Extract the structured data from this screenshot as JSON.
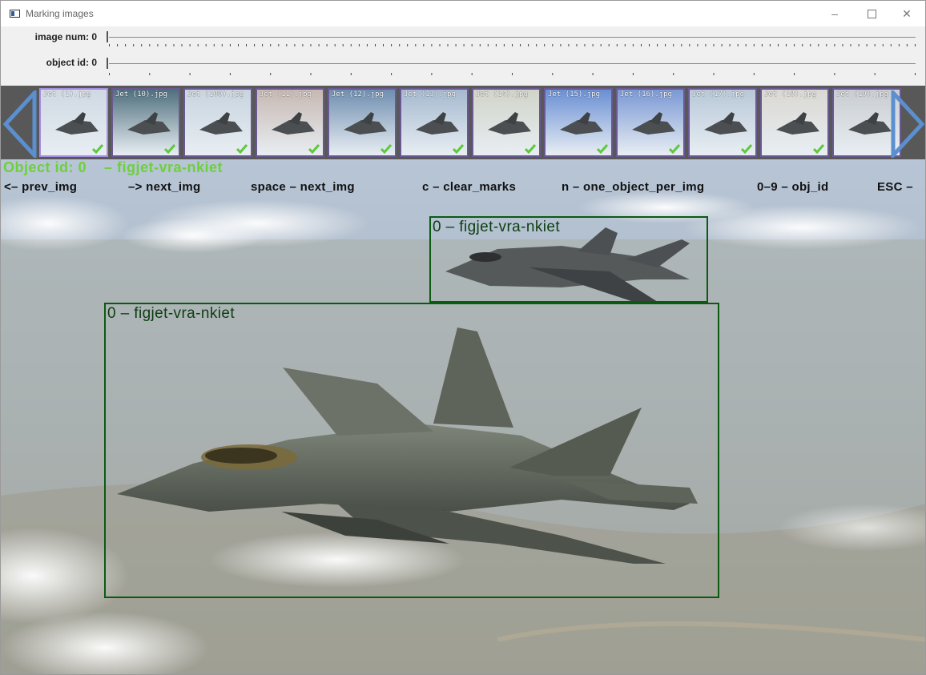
{
  "window": {
    "title": "Marking images",
    "controls": {
      "minimize": "–",
      "maximize": "□",
      "close": "✕"
    }
  },
  "trackbars": [
    {
      "label": "image num: 0",
      "value": 0
    },
    {
      "label": "object id: 0",
      "value": 0
    }
  ],
  "thumbnails": [
    {
      "caption": "Jet (1).jpg",
      "marked": true,
      "selected": true
    },
    {
      "caption": "Jet (10).jpg",
      "marked": true,
      "selected": false
    },
    {
      "caption": "Jet (100).jpg",
      "marked": true,
      "selected": false
    },
    {
      "caption": "Jet (11).jpg",
      "marked": true,
      "selected": false
    },
    {
      "caption": "Jet (12).jpg",
      "marked": true,
      "selected": false
    },
    {
      "caption": "Jet (13).jpg",
      "marked": true,
      "selected": false
    },
    {
      "caption": "Jet (14).jpg",
      "marked": true,
      "selected": false
    },
    {
      "caption": "Jet (15).jpg",
      "marked": true,
      "selected": false
    },
    {
      "caption": "Jet (16).jpg",
      "marked": true,
      "selected": false
    },
    {
      "caption": "Jet (17).jpg",
      "marked": true,
      "selected": false
    },
    {
      "caption": "Jet (18).jpg",
      "marked": true,
      "selected": false
    },
    {
      "caption": "Jet (19).jpg",
      "marked": false,
      "selected": false
    }
  ],
  "overlay": {
    "object_header": "Object id: 0    – figjet-vra-nkiet",
    "keys": [
      "<– prev_img",
      "–> next_img",
      "space – next_img",
      "c – clear_marks",
      "n – one_object_per_img",
      "0–9 – obj_id",
      "ESC –"
    ]
  },
  "boxes": [
    {
      "label": "0 – figjet-vra-nkiet"
    },
    {
      "label": "0 – figjet-vra-nkiet"
    }
  ],
  "colors": {
    "header_text": "#6ed03a",
    "bbox": "#0c5a12",
    "bbox_label": "#0d3d12",
    "nav_arrow": "#5b8fcf",
    "thumb_border": "#6a5891",
    "check": "#5ec93c"
  },
  "icons": {
    "nav_prev": "triangle-left-icon",
    "nav_next": "triangle-right-icon",
    "marked": "checkmark-icon"
  }
}
